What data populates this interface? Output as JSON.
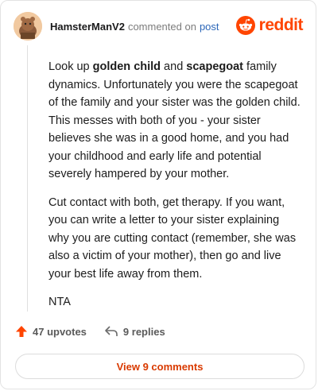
{
  "header": {
    "username": "HamsterManV2",
    "action_text": "commented on",
    "post_link": "post",
    "brand": "reddit"
  },
  "comment": {
    "p1_pre": "Look up ",
    "p1_b1": "golden child",
    "p1_mid": " and ",
    "p1_b2": "scapegoat",
    "p1_post": " family dynamics. Unfortunately you were the scapegoat of the family and your sister was the golden child. This messes with both of you - your sister believes she was in a good home, and you had your childhood and early life and potential severely hampered by your mother.",
    "p2": "Cut contact with both, get therapy. If you want, you can write a letter to your sister explaining why you are cutting contact (remember, she was also a victim of your mother), then go and live your best life away from them.",
    "p3": "NTA"
  },
  "actions": {
    "upvotes": "47 upvotes",
    "replies": "9 replies"
  },
  "view_comments": "View 9 comments",
  "colors": {
    "brand": "#ff4500",
    "upvote": "#ff4500",
    "link": "#2c67b8",
    "view_button_text": "#d93a00"
  }
}
